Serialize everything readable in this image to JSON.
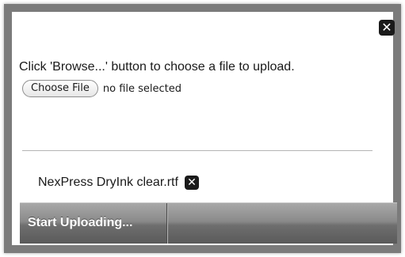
{
  "dialog": {
    "close_icon": "close-x-icon",
    "instruction": "Click 'Browse...' button to choose a file to upload.",
    "choose_file_label": "Choose File",
    "no_file_text": "no file selected"
  },
  "queue": {
    "items": [
      {
        "name": "NexPress DryInk clear.rtf",
        "remove_icon": "remove-x-icon"
      }
    ]
  },
  "toolbar": {
    "start_label": "Start Uploading..."
  },
  "colors": {
    "frame": "#7b7b7b",
    "toolbar_top": "#a8a8a8",
    "toolbar_bottom": "#5a5a5a",
    "icon_bg": "#1a1a1a"
  }
}
